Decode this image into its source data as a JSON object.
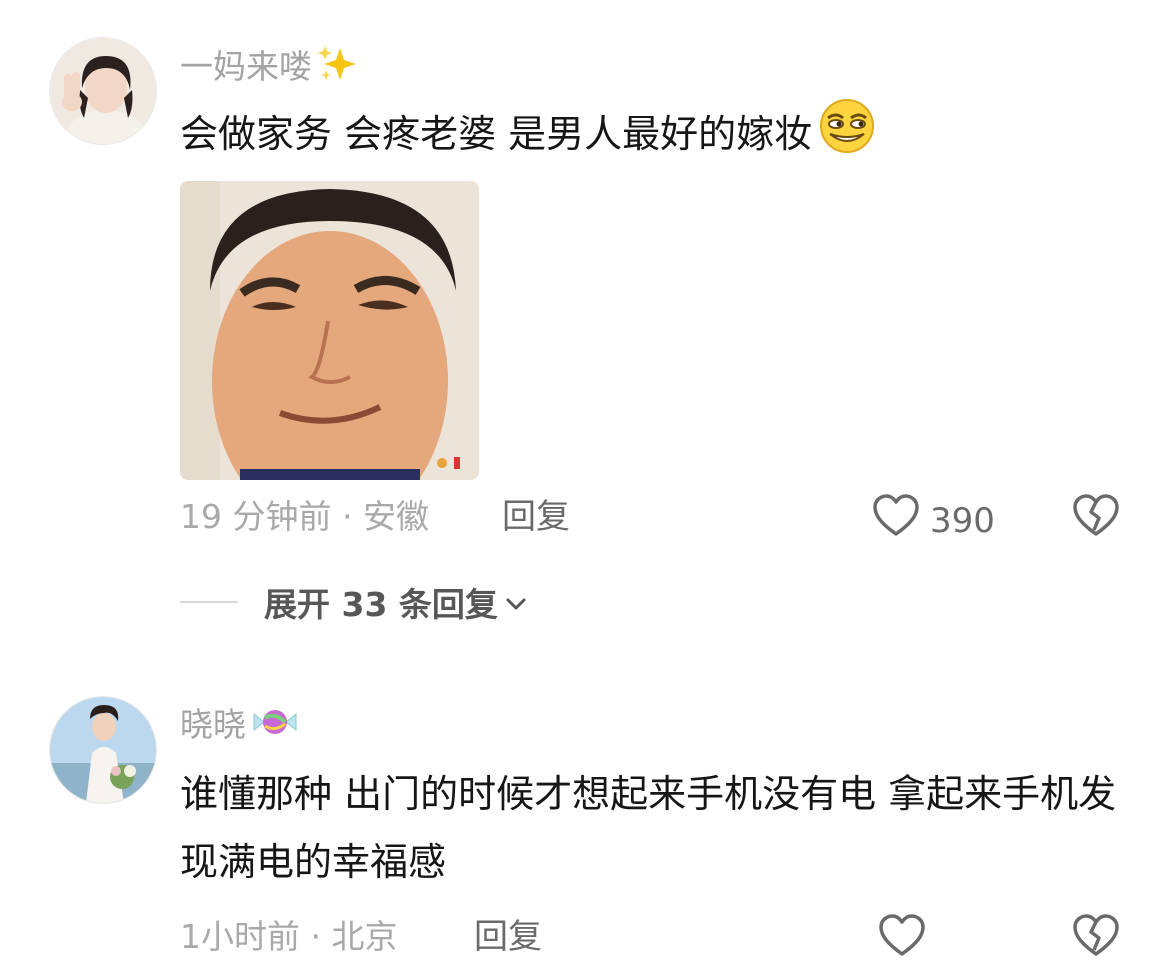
{
  "comments": [
    {
      "username": "一妈来喽",
      "username_emoji": "sparkles-icon",
      "text": "会做家务 会疼老婆 是男人最好的嫁妆",
      "text_emoji": "smirk-emoji",
      "time_location": "19 分钟前 · 安徽",
      "reply_label": "回复",
      "like_count": "390",
      "expand_label": "展开 33 条回复"
    },
    {
      "username": "晓晓",
      "username_emoji": "candy-icon",
      "text": "谁懂那种 出门的时候才想起来手机没有电  拿起来手机发现满电的幸福感",
      "time_location": "1小时前 · 北京",
      "reply_label": "回复"
    }
  ],
  "colors": {
    "username": "#a3a3a3",
    "text": "#161616",
    "meta": "#a9a9a9",
    "action": "#6a6a6a"
  }
}
